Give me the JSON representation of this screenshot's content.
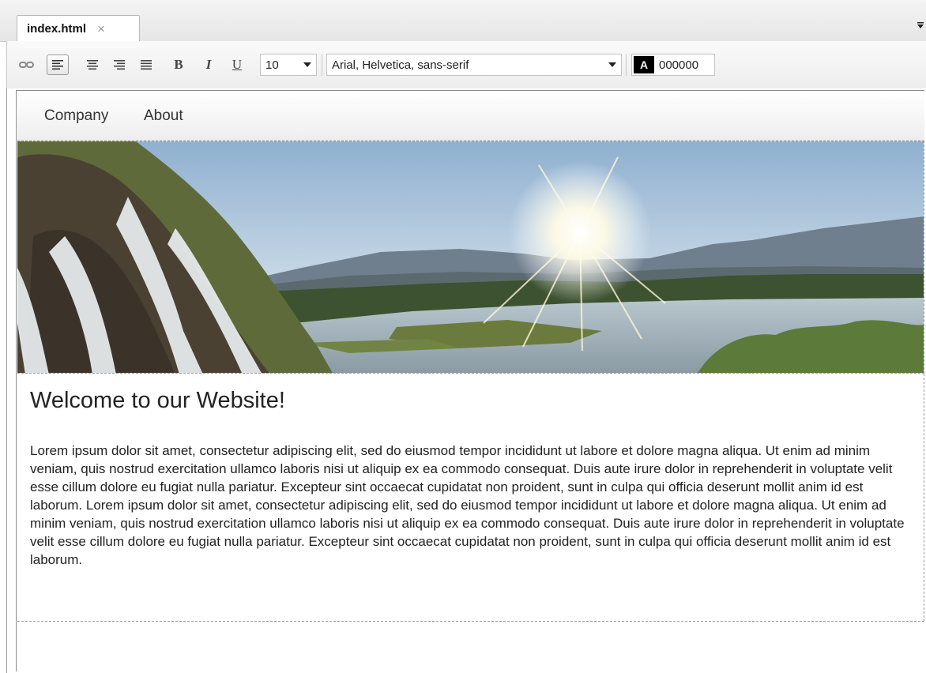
{
  "tab": {
    "filename": "index.html",
    "close_symbol": "×"
  },
  "toolbar": {
    "bold_label": "B",
    "italic_label": "I",
    "underline_label": "U",
    "font_size": "10",
    "font_family": "Arial, Helvetica, sans-serif",
    "text_color_letter": "A",
    "text_color_hex": "000000",
    "icons": [
      "link-icon",
      "align-left-icon",
      "align-center-icon",
      "align-right-icon",
      "align-justify-icon"
    ]
  },
  "page": {
    "nav": [
      "Company",
      "About"
    ],
    "heading": "Welcome to our Website!",
    "paragraph": "Lorem ipsum dolor sit amet, consectetur adipiscing elit, sed do eiusmod tempor incididunt ut labore et dolore magna aliqua. Ut enim ad minim veniam, quis nostrud exercitation ullamco laboris nisi ut aliquip ex ea commodo consequat. Duis aute irure dolor in reprehenderit in voluptate velit esse cillum dolore eu fugiat nulla pariatur. Excepteur sint occaecat cupidatat non proident, sunt in culpa qui officia deserunt mollit anim id est laborum. Lorem ipsum dolor sit amet, consectetur adipiscing elit, sed do eiusmod tempor incididunt ut labore et dolore magna aliqua. Ut enim ad minim veniam, quis nostrud exercitation ullamco laboris nisi ut aliquip ex ea commodo consequat. Duis aute irure dolor in reprehenderit in voluptate velit esse cillum dolore eu fugiat nulla pariatur. Excepteur sint occaecat cupidatat non proident, sunt in culpa qui officia deserunt mollit anim id est laborum."
  },
  "colors": {
    "text_color": "#000000"
  }
}
